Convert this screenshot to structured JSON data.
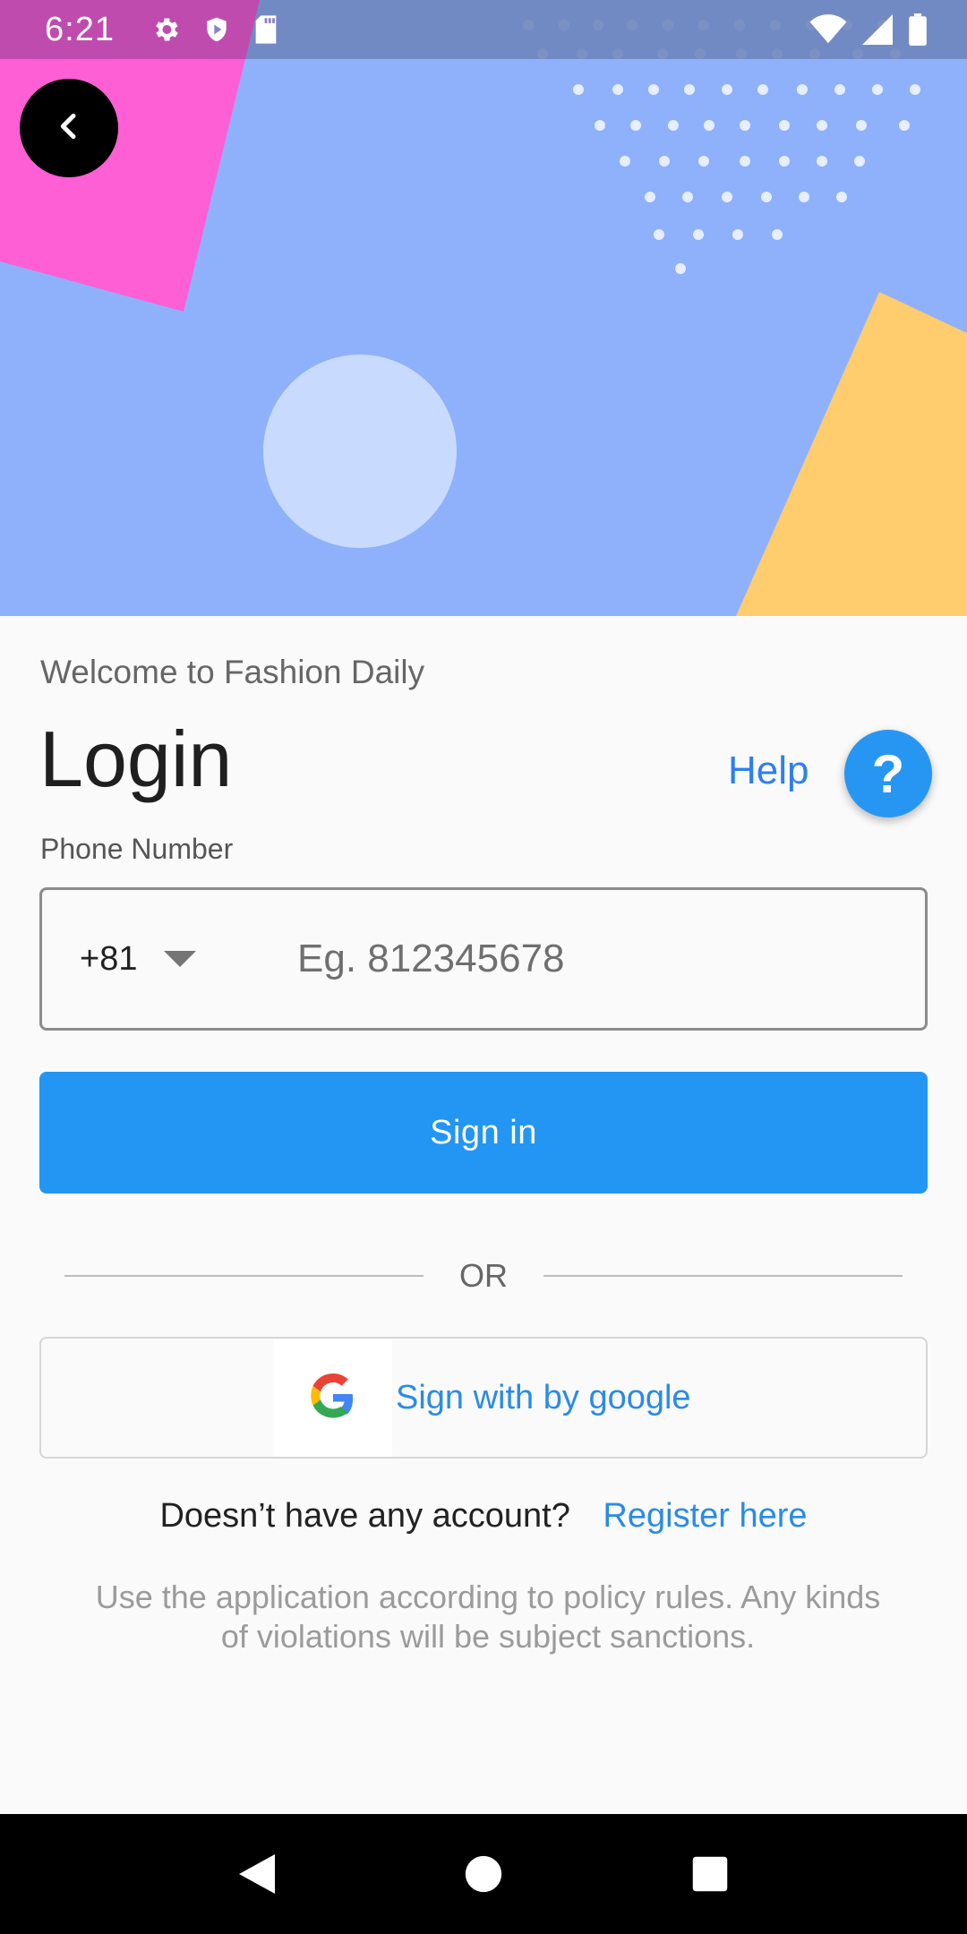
{
  "status_bar": {
    "time": "6:21",
    "left_icons": [
      "gear-icon",
      "shield-play-icon",
      "sd-card-icon"
    ],
    "right_icons": [
      "wifi-icon",
      "signal-icon",
      "battery-icon"
    ]
  },
  "hero": {
    "colors": {
      "background": "#8fb1fc",
      "pink": "#ff5fd5",
      "yellow": "#ffcc6e",
      "circle": "#c8dbff",
      "status_tint": "#6f86be"
    }
  },
  "header": {
    "back_icon": "chevron-left-icon",
    "welcome": "Welcome to Fashion Daily",
    "title": "Login",
    "help_label": "Help",
    "help_icon_text": "?"
  },
  "form": {
    "phone_label": "Phone Number",
    "country_code": "+81",
    "phone_placeholder": "Eg. 812345678",
    "phone_value": "",
    "signin_label": "Sign in",
    "or_text": "OR",
    "google_label": "Sign with by google",
    "google_icon": "google-icon"
  },
  "footer": {
    "register_question": "Doesn’t have any account?",
    "register_link": "Register here",
    "policy": "Use the application according to policy rules. Any kinds of violations will be subject sanctions."
  },
  "nav": {
    "icons": [
      "back-triangle-icon",
      "home-circle-icon",
      "recents-square-icon"
    ]
  },
  "colors": {
    "accent": "#2396f3",
    "link": "#2a8be6",
    "help_link": "#2e7ff0"
  }
}
